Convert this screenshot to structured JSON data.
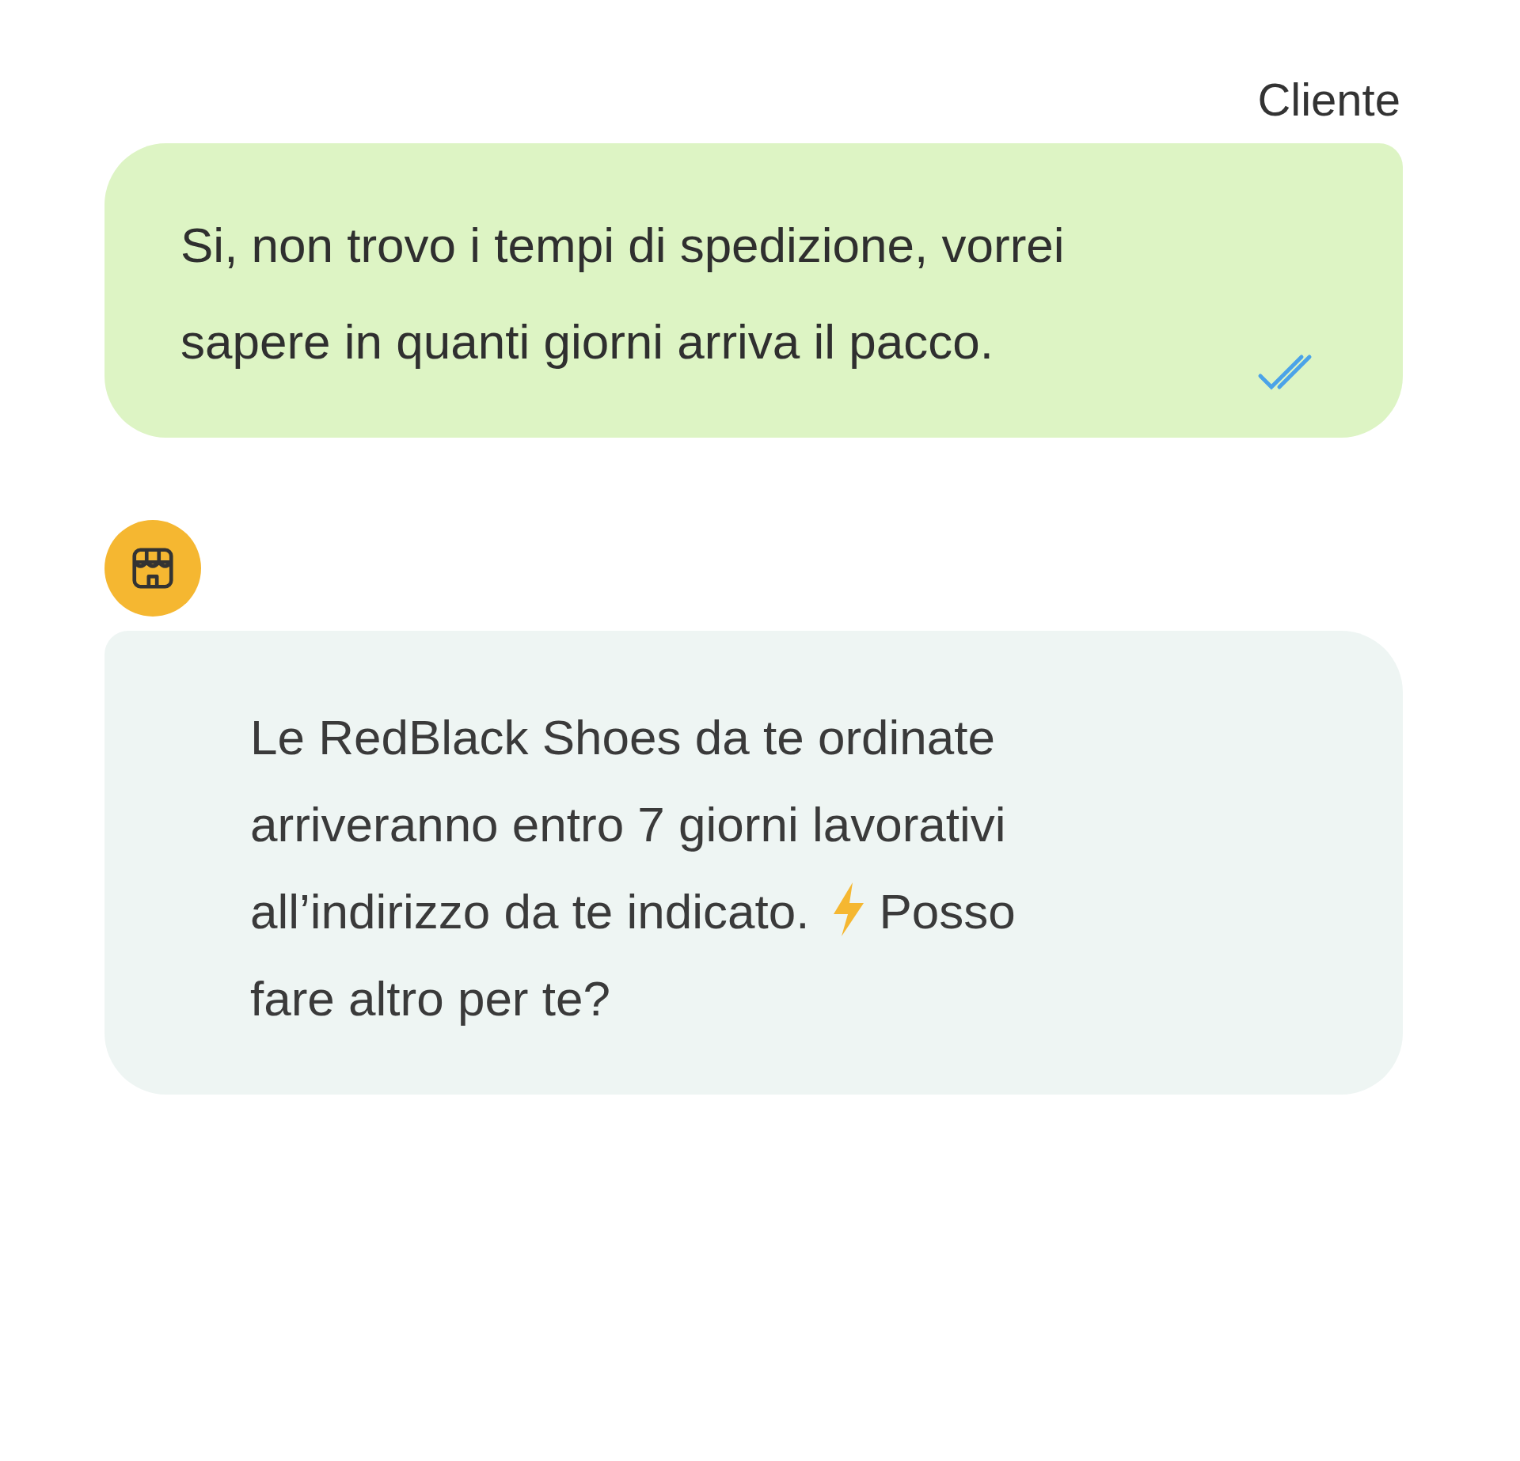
{
  "messages": [
    {
      "kind": "outgoing",
      "sender": "Cliente",
      "text": "Si, non trovo i tempi di spedizione, vorrei sapere in quanti giorni arriva il pacco.",
      "read": true
    },
    {
      "kind": "incoming",
      "text_before_icon": "Le RedBlack Shoes da te ordinate arriveranno entro 7 giorni lavorativi all’indirizzo da te indicato.",
      "text_after_icon": "Posso fare altro per te?"
    }
  ]
}
